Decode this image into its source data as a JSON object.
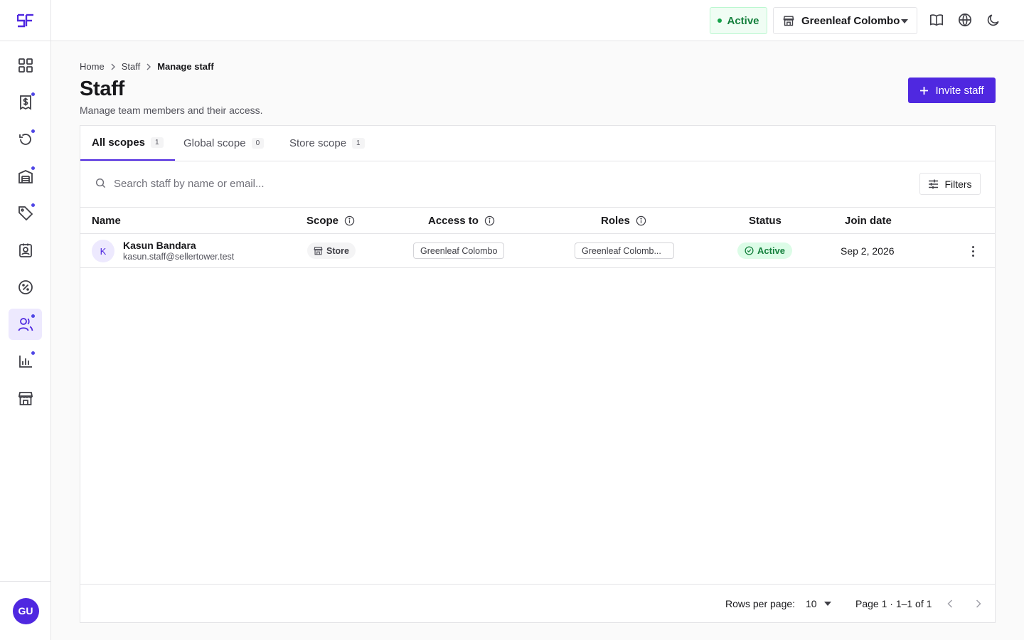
{
  "sidebar": {
    "logo_icon": "sellertower-logo-icon",
    "items": [
      {
        "icon": "dashboard-grid-icon",
        "badge": false,
        "active": false
      },
      {
        "icon": "receipt-dollar-icon",
        "badge": true,
        "active": false
      },
      {
        "icon": "history-icon",
        "badge": true,
        "active": false
      },
      {
        "icon": "inventory-box-icon",
        "badge": true,
        "active": false
      },
      {
        "icon": "tag-icon",
        "badge": true,
        "active": false
      },
      {
        "icon": "contact-card-icon",
        "badge": false,
        "active": false
      },
      {
        "icon": "discount-badge-icon",
        "badge": false,
        "active": false
      },
      {
        "icon": "users-icon",
        "badge": true,
        "active": true
      },
      {
        "icon": "bar-chart-icon",
        "badge": true,
        "active": false
      },
      {
        "icon": "storefront-icon",
        "badge": false,
        "active": false
      }
    ],
    "user_initials": "GU"
  },
  "topbar": {
    "status": "Active",
    "store_name": "Greenleaf Colombo",
    "icons": [
      "book-icon",
      "globe-icon",
      "moon-icon"
    ]
  },
  "breadcrumb": {
    "home": "Home",
    "staff": "Staff",
    "current": "Manage staff"
  },
  "page": {
    "title": "Staff",
    "subtitle": "Manage team members and their access.",
    "invite_label": "Invite staff"
  },
  "tabs": [
    {
      "label": "All scopes",
      "count": "1",
      "active": true
    },
    {
      "label": "Global scope",
      "count": "0",
      "active": false
    },
    {
      "label": "Store scope",
      "count": "1",
      "active": false
    }
  ],
  "search": {
    "placeholder": "Search staff by name or email...",
    "value": "",
    "filters_label": "Filters"
  },
  "table": {
    "columns": {
      "name": "Name",
      "scope": "Scope",
      "access": "Access to",
      "roles": "Roles",
      "status": "Status",
      "join_date": "Join date"
    },
    "rows": [
      {
        "initial": "K",
        "name": "Kasun Bandara",
        "email": "kasun.staff@sellertower.test",
        "scope": "Store",
        "access": "Greenleaf Colombo",
        "roles": "Greenleaf Colomb...",
        "status": "Active",
        "join_date": "Sep 2, 2026"
      }
    ]
  },
  "pagination": {
    "rows_label": "Rows per page:",
    "rows_value": "10",
    "page_info": "Page 1 · 1–1 of 1"
  },
  "colors": {
    "brand": "#4f28e0",
    "status_green": "#15803d"
  }
}
